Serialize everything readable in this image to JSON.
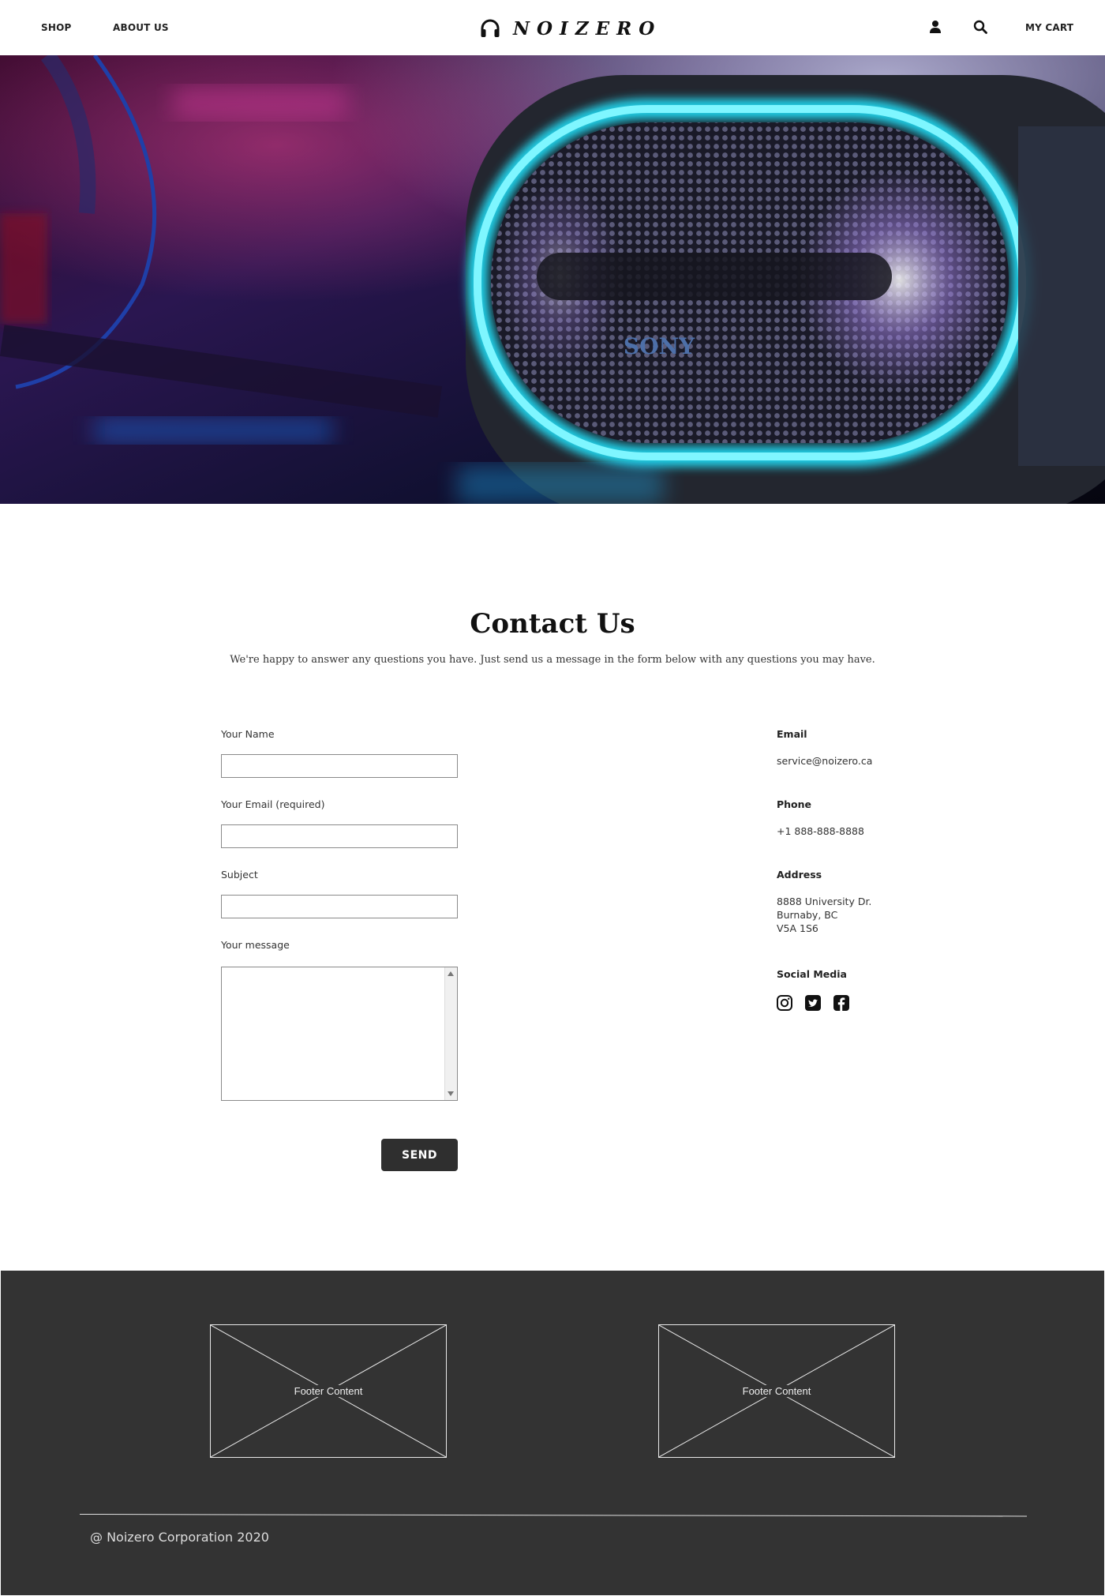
{
  "header": {
    "nav": {
      "shop": "SHOP",
      "about": "ABOUT US"
    },
    "logo_text": "NOIZERO",
    "logo_icon": "headphones-icon",
    "user_icon": "user-icon",
    "search_icon": "search-icon",
    "cart_label": "MY CART"
  },
  "hero": {
    "brand_label": "SONY"
  },
  "contact": {
    "title": "Contact Us",
    "subtitle": "We're happy to answer any questions you have. Just send us a message in the form below with any questions you may have.",
    "form": {
      "name_label": "Your Name",
      "name_value": "",
      "email_label": "Your Email (required)",
      "email_value": "",
      "subject_label": "Subject",
      "subject_value": "",
      "message_label": "Your message",
      "message_value": "",
      "send_label": "SEND"
    },
    "info": {
      "email_heading": "Email",
      "email_value": "service@noizero.ca",
      "phone_heading": "Phone",
      "phone_value": "+1 888-888-8888",
      "address_heading": "Address",
      "address_lines": [
        "8888 University Dr.",
        "Burnaby, BC",
        "V5A 1S6"
      ],
      "social_heading": "Social Media",
      "social_icons": [
        "instagram-icon",
        "twitter-icon",
        "facebook-icon"
      ]
    }
  },
  "footer": {
    "box_1_label": "Footer Content",
    "box_2_label": "Footer Content",
    "copyright": "@ Noizero Corporation 2020"
  },
  "colors": {
    "footer_bg": "#333333",
    "button_bg": "#2f2f2f",
    "hero_accent": "#22e6ff"
  }
}
